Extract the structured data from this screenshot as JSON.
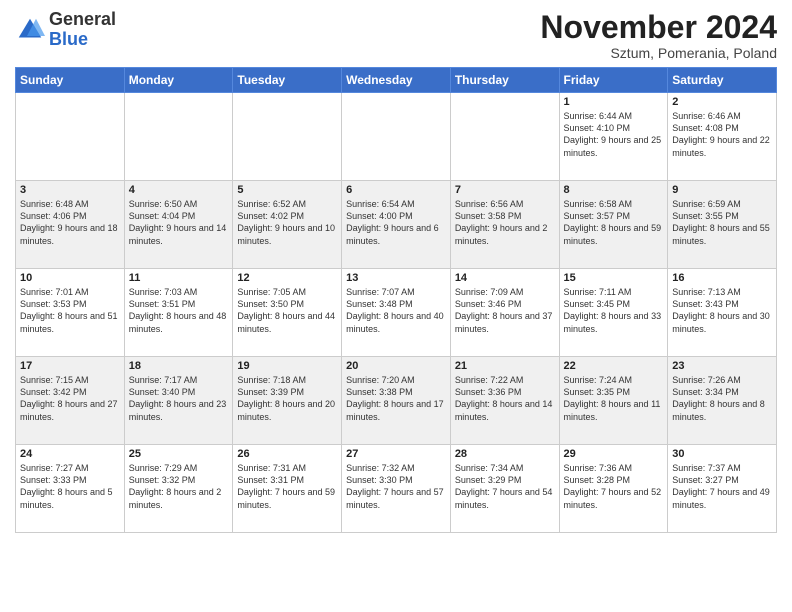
{
  "logo": {
    "general": "General",
    "blue": "Blue"
  },
  "title": "November 2024",
  "location": "Sztum, Pomerania, Poland",
  "weekdays": [
    "Sunday",
    "Monday",
    "Tuesday",
    "Wednesday",
    "Thursday",
    "Friday",
    "Saturday"
  ],
  "rows": [
    [
      {
        "day": "",
        "info": ""
      },
      {
        "day": "",
        "info": ""
      },
      {
        "day": "",
        "info": ""
      },
      {
        "day": "",
        "info": ""
      },
      {
        "day": "",
        "info": ""
      },
      {
        "day": "1",
        "info": "Sunrise: 6:44 AM\nSunset: 4:10 PM\nDaylight: 9 hours and 25 minutes."
      },
      {
        "day": "2",
        "info": "Sunrise: 6:46 AM\nSunset: 4:08 PM\nDaylight: 9 hours and 22 minutes."
      }
    ],
    [
      {
        "day": "3",
        "info": "Sunrise: 6:48 AM\nSunset: 4:06 PM\nDaylight: 9 hours and 18 minutes."
      },
      {
        "day": "4",
        "info": "Sunrise: 6:50 AM\nSunset: 4:04 PM\nDaylight: 9 hours and 14 minutes."
      },
      {
        "day": "5",
        "info": "Sunrise: 6:52 AM\nSunset: 4:02 PM\nDaylight: 9 hours and 10 minutes."
      },
      {
        "day": "6",
        "info": "Sunrise: 6:54 AM\nSunset: 4:00 PM\nDaylight: 9 hours and 6 minutes."
      },
      {
        "day": "7",
        "info": "Sunrise: 6:56 AM\nSunset: 3:58 PM\nDaylight: 9 hours and 2 minutes."
      },
      {
        "day": "8",
        "info": "Sunrise: 6:58 AM\nSunset: 3:57 PM\nDaylight: 8 hours and 59 minutes."
      },
      {
        "day": "9",
        "info": "Sunrise: 6:59 AM\nSunset: 3:55 PM\nDaylight: 8 hours and 55 minutes."
      }
    ],
    [
      {
        "day": "10",
        "info": "Sunrise: 7:01 AM\nSunset: 3:53 PM\nDaylight: 8 hours and 51 minutes."
      },
      {
        "day": "11",
        "info": "Sunrise: 7:03 AM\nSunset: 3:51 PM\nDaylight: 8 hours and 48 minutes."
      },
      {
        "day": "12",
        "info": "Sunrise: 7:05 AM\nSunset: 3:50 PM\nDaylight: 8 hours and 44 minutes."
      },
      {
        "day": "13",
        "info": "Sunrise: 7:07 AM\nSunset: 3:48 PM\nDaylight: 8 hours and 40 minutes."
      },
      {
        "day": "14",
        "info": "Sunrise: 7:09 AM\nSunset: 3:46 PM\nDaylight: 8 hours and 37 minutes."
      },
      {
        "day": "15",
        "info": "Sunrise: 7:11 AM\nSunset: 3:45 PM\nDaylight: 8 hours and 33 minutes."
      },
      {
        "day": "16",
        "info": "Sunrise: 7:13 AM\nSunset: 3:43 PM\nDaylight: 8 hours and 30 minutes."
      }
    ],
    [
      {
        "day": "17",
        "info": "Sunrise: 7:15 AM\nSunset: 3:42 PM\nDaylight: 8 hours and 27 minutes."
      },
      {
        "day": "18",
        "info": "Sunrise: 7:17 AM\nSunset: 3:40 PM\nDaylight: 8 hours and 23 minutes."
      },
      {
        "day": "19",
        "info": "Sunrise: 7:18 AM\nSunset: 3:39 PM\nDaylight: 8 hours and 20 minutes."
      },
      {
        "day": "20",
        "info": "Sunrise: 7:20 AM\nSunset: 3:38 PM\nDaylight: 8 hours and 17 minutes."
      },
      {
        "day": "21",
        "info": "Sunrise: 7:22 AM\nSunset: 3:36 PM\nDaylight: 8 hours and 14 minutes."
      },
      {
        "day": "22",
        "info": "Sunrise: 7:24 AM\nSunset: 3:35 PM\nDaylight: 8 hours and 11 minutes."
      },
      {
        "day": "23",
        "info": "Sunrise: 7:26 AM\nSunset: 3:34 PM\nDaylight: 8 hours and 8 minutes."
      }
    ],
    [
      {
        "day": "24",
        "info": "Sunrise: 7:27 AM\nSunset: 3:33 PM\nDaylight: 8 hours and 5 minutes."
      },
      {
        "day": "25",
        "info": "Sunrise: 7:29 AM\nSunset: 3:32 PM\nDaylight: 8 hours and 2 minutes."
      },
      {
        "day": "26",
        "info": "Sunrise: 7:31 AM\nSunset: 3:31 PM\nDaylight: 7 hours and 59 minutes."
      },
      {
        "day": "27",
        "info": "Sunrise: 7:32 AM\nSunset: 3:30 PM\nDaylight: 7 hours and 57 minutes."
      },
      {
        "day": "28",
        "info": "Sunrise: 7:34 AM\nSunset: 3:29 PM\nDaylight: 7 hours and 54 minutes."
      },
      {
        "day": "29",
        "info": "Sunrise: 7:36 AM\nSunset: 3:28 PM\nDaylight: 7 hours and 52 minutes."
      },
      {
        "day": "30",
        "info": "Sunrise: 7:37 AM\nSunset: 3:27 PM\nDaylight: 7 hours and 49 minutes."
      }
    ]
  ]
}
